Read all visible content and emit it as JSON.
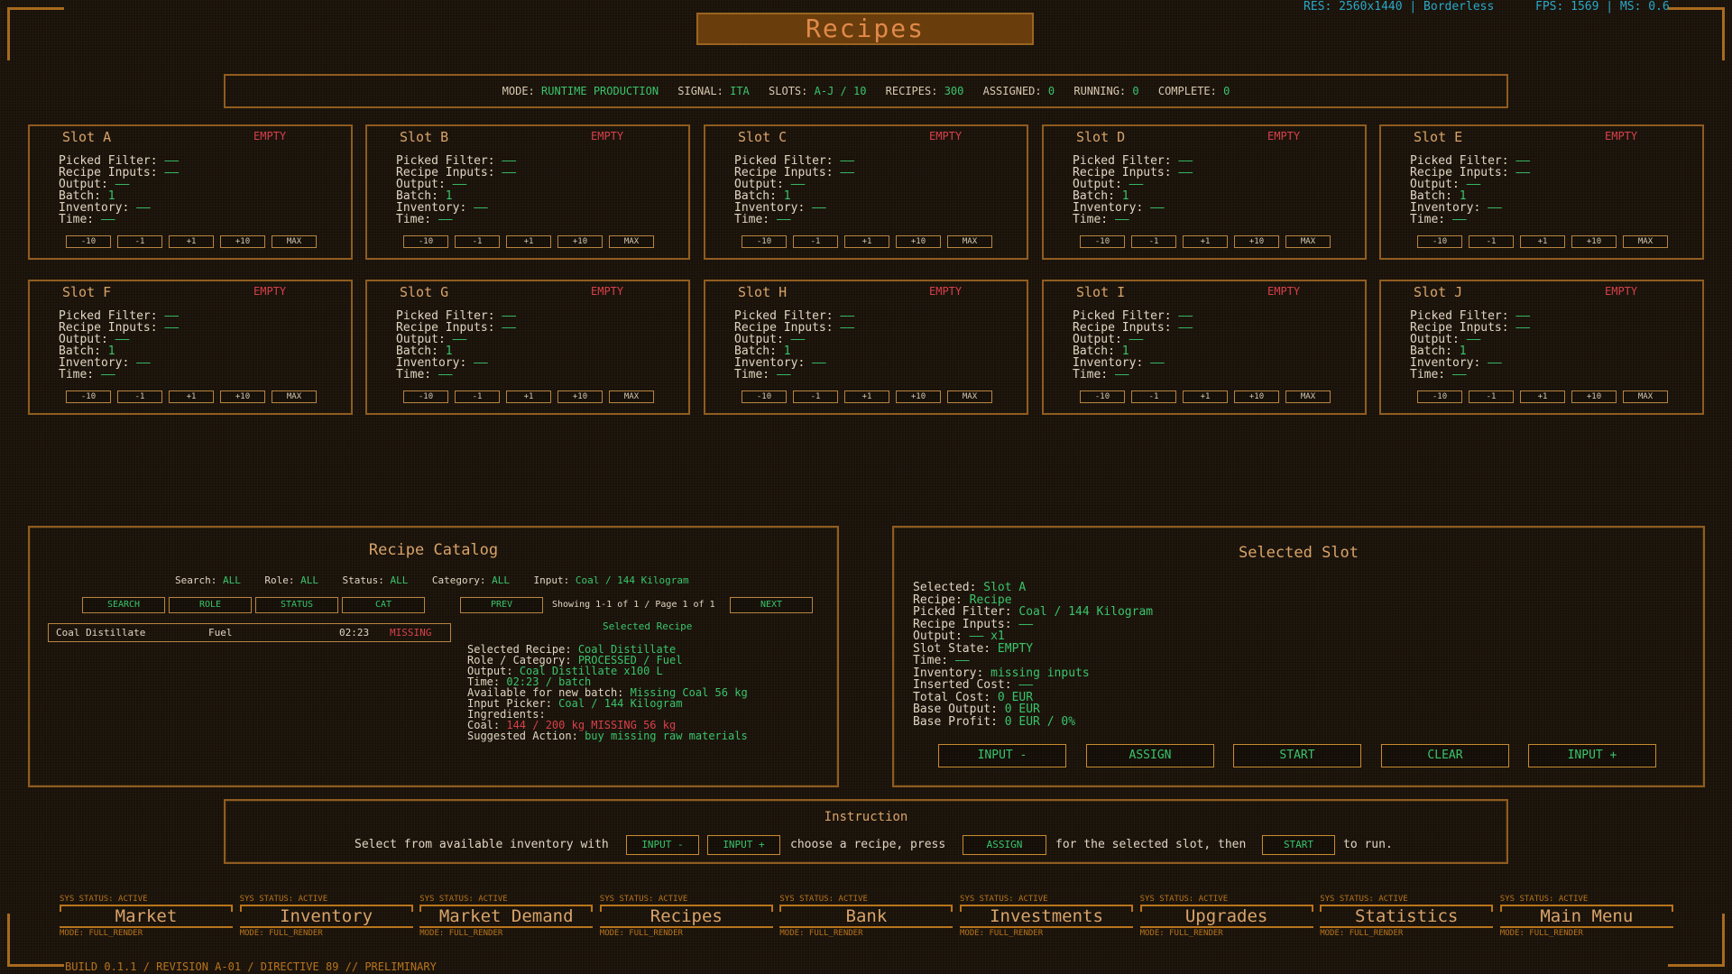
{
  "title": "Recipes",
  "sysinfo": {
    "res": "RES: 2560x1440 | Borderless",
    "fps": "FPS: 1569 | MS: 0.6"
  },
  "modebar": {
    "mode_k": "MODE:",
    "mode_v": "RUNTIME PRODUCTION",
    "signal_k": "SIGNAL:",
    "signal_v": "ITA",
    "slots_k": "SLOTS:",
    "slots_v": "A-J / 10",
    "recipes_k": "RECIPES:",
    "recipes_v": "300",
    "assigned_k": "ASSIGNED:",
    "assigned_v": "0",
    "running_k": "RUNNING:",
    "running_v": "0",
    "complete_k": "COMPLETE:",
    "complete_v": "0"
  },
  "slot_common": {
    "state": "EMPTY",
    "picked_filter": "Picked Filter:",
    "recipe_inputs": "Recipe Inputs:",
    "output": "Output:",
    "batch": "Batch:",
    "inventory": "Inventory:",
    "time": "Time:",
    "dash": "——",
    "batch_value": "1",
    "btn_m10": "-10",
    "btn_m1": "-1",
    "btn_p1": "+1",
    "btn_p10": "+10",
    "btn_max": "MAX"
  },
  "slots": [
    "Slot A",
    "Slot B",
    "Slot C",
    "Slot D",
    "Slot E",
    "Slot F",
    "Slot G",
    "Slot H",
    "Slot I",
    "Slot J"
  ],
  "catalog": {
    "title": "Recipe Catalog",
    "search_k": "Search:",
    "search_v": "ALL",
    "role_k": "Role:",
    "role_v": "ALL",
    "status_k": "Status:",
    "status_v": "ALL",
    "category_k": "Category:",
    "category_v": "ALL",
    "input_k": "Input:",
    "input_v": "Coal / 144 Kilogram",
    "btn_search": "SEARCH",
    "btn_role": "ROLE",
    "btn_status": "STATUS",
    "btn_cat": "CAT",
    "btn_prev": "PREV",
    "btn_next": "NEXT",
    "showing": "Showing 1-1 of 1 / Page 1 of 1",
    "row": {
      "name": "Coal Distillate",
      "role": "Fuel",
      "time": "02:23",
      "status": "MISSING"
    },
    "selected_header": "Selected Recipe",
    "detail": {
      "sel_k": "Selected Recipe:",
      "sel_v": "Coal Distillate",
      "rc_k": "Role / Category:",
      "rc_v": "PROCESSED / Fuel",
      "out_k": "Output:",
      "out_v": "Coal Distillate x100 L",
      "time_k": "Time:",
      "time_v": "02:23 / batch",
      "avail_k": "Available for new batch:",
      "avail_v": "Missing Coal 56 kg",
      "picker_k": "Input Picker:",
      "picker_v": "Coal / 144 Kilogram",
      "ingr_k": "Ingredients:",
      "coal_k": "Coal:",
      "coal_v": "144 / 200 kg MISSING 56 kg",
      "sugg_k": "Suggested Action:",
      "sugg_v": "buy missing raw materials"
    }
  },
  "selected_slot": {
    "title": "Selected Slot",
    "selected_k": "Selected:",
    "selected_v": "Slot A",
    "recipe_k": "Recipe:",
    "recipe_v": "Recipe",
    "filter_k": "Picked Filter:",
    "filter_v": "Coal / 144 Kilogram",
    "inputs_k": "Recipe Inputs:",
    "inputs_v": "——",
    "output_k": "Output:",
    "output_v": "—— x1",
    "state_k": "Slot State:",
    "state_v": "EMPTY",
    "time_k": "Time:",
    "time_v": "——",
    "inv_k": "Inventory:",
    "inv_v": "missing inputs",
    "icost_k": "Inserted Cost:",
    "icost_v": "——",
    "tcost_k": "Total Cost:",
    "tcost_v": "0 EUR",
    "bout_k": "Base Output:",
    "bout_v": "0 EUR",
    "bprofit_k": "Base Profit:",
    "bprofit_v": "0 EUR / 0%",
    "btn_input_minus": "INPUT -",
    "btn_assign": "ASSIGN",
    "btn_start": "START",
    "btn_clear": "CLEAR",
    "btn_input_plus": "INPUT +"
  },
  "instruction": {
    "title": "Instruction",
    "t1": "Select from available inventory with",
    "b1": "INPUT -",
    "b2": "INPUT +",
    "t2": "choose a recipe, press",
    "b3": "ASSIGN",
    "t3": "for the selected slot, then",
    "b4": "START",
    "t4": "to run."
  },
  "nav": {
    "status": "SYS STATUS: ACTIVE",
    "mode": "MODE: FULL_RENDER",
    "items": [
      "Market",
      "Inventory",
      "Market Demand",
      "Recipes",
      "Bank",
      "Investments",
      "Upgrades",
      "Statistics",
      "Main Menu"
    ]
  },
  "footer": "BUILD 0.1.1 / REVISION A-01 / DIRECTIVE 89 // PRELIMINARY"
}
